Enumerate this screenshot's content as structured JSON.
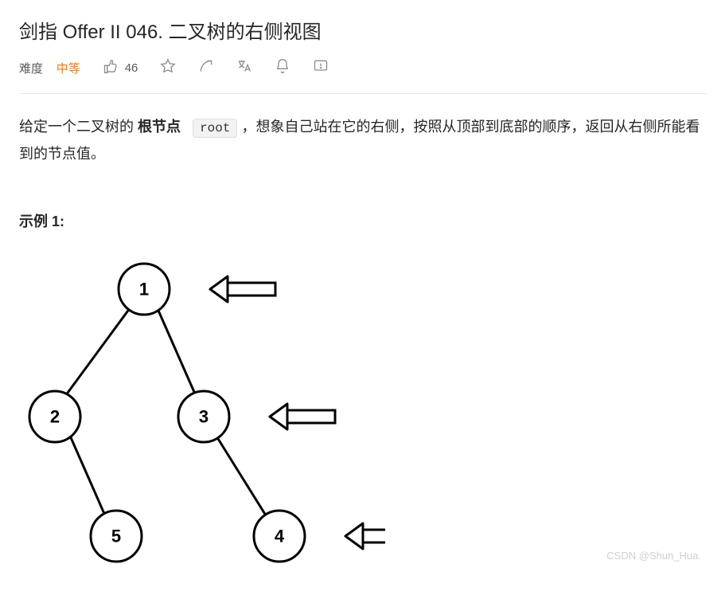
{
  "title": "剑指 Offer II 046. 二叉树的右侧视图",
  "meta": {
    "difficulty_label": "难度",
    "difficulty_value": "中等",
    "like_count": "46"
  },
  "description": {
    "p1_a": "给定一个二叉树的 ",
    "p1_b_strong": "根节点",
    "p1_code": "root",
    "p1_c": "，想象自己站在它的右侧，按照从顶部到底部的顺序，返回从右侧所能看到的节点值。"
  },
  "example": {
    "heading": "示例 1:"
  },
  "tree": {
    "nodes": {
      "n1": "1",
      "n2": "2",
      "n3": "3",
      "n5": "5",
      "n4": "4"
    },
    "edges": [
      [
        "n1",
        "n2"
      ],
      [
        "n1",
        "n3"
      ],
      [
        "n2",
        "n5"
      ],
      [
        "n3",
        "n4"
      ]
    ],
    "right_view_nodes": [
      "n1",
      "n3",
      "n4"
    ]
  },
  "watermark": "CSDN @Shun_Hua."
}
